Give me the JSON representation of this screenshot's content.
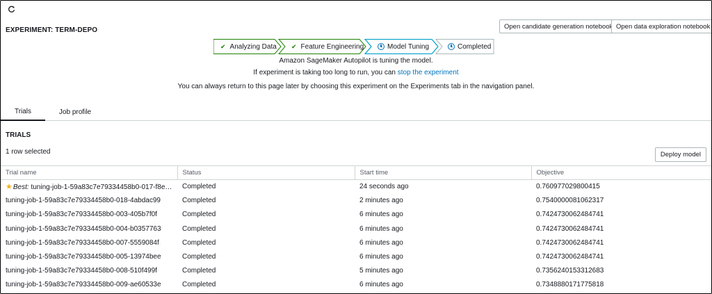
{
  "header": {
    "refresh_icon": "refresh-icon",
    "experiment_title": "EXPERIMENT: TERM-DEPO",
    "open_candidate_notebook_label": "Open candidate generation notebook",
    "open_data_notebook_label": "Open data exploration notebook"
  },
  "progress": {
    "steps": [
      {
        "label": "Analyzing Data",
        "state": "done",
        "icon": "check-icon"
      },
      {
        "label": "Feature Engineering",
        "state": "done",
        "icon": "check-icon"
      },
      {
        "label": "Model Tuning",
        "state": "in-progress",
        "icon": "clock-icon"
      },
      {
        "label": "Completed",
        "state": "pending",
        "icon": "clock-icon"
      }
    ]
  },
  "messages": {
    "tuning": "Amazon SageMaker Autopilot is tuning the model.",
    "long_run_prefix": "If experiment is taking too long to run, you can ",
    "stop_link": "stop the experiment",
    "return_info": "You can always return to this page later by choosing this experiment on the Experiments tab in the navigation panel."
  },
  "tabs": [
    {
      "label": "Trials",
      "active": true
    },
    {
      "label": "Job profile",
      "active": false
    }
  ],
  "trials": {
    "title": "TRIALS",
    "selected_count": "1 row selected",
    "deploy_label": "Deploy model",
    "columns": [
      "Trial name",
      "Status",
      "Start time",
      "Objective"
    ],
    "best_label": "Best:",
    "rows": [
      {
        "name": "tuning-job-1-59a83c7e79334458b0-017-f8ef4...",
        "status": "Completed",
        "start": "24 seconds ago",
        "objective": "0.760977029800415",
        "best": true
      },
      {
        "name": "tuning-job-1-59a83c7e79334458b0-018-4abdac99",
        "status": "Completed",
        "start": "2 minutes ago",
        "objective": "0.7540000081062317",
        "best": false
      },
      {
        "name": "tuning-job-1-59a83c7e79334458b0-003-405b7f0f",
        "status": "Completed",
        "start": "6 minutes ago",
        "objective": "0.7424730062484741",
        "best": false
      },
      {
        "name": "tuning-job-1-59a83c7e79334458b0-004-b0357763",
        "status": "Completed",
        "start": "6 minutes ago",
        "objective": "0.7424730062484741",
        "best": false
      },
      {
        "name": "tuning-job-1-59a83c7e79334458b0-007-5559084f",
        "status": "Completed",
        "start": "6 minutes ago",
        "objective": "0.7424730062484741",
        "best": false
      },
      {
        "name": "tuning-job-1-59a83c7e79334458b0-005-13974bee",
        "status": "Completed",
        "start": "6 minutes ago",
        "objective": "0.7424730062484741",
        "best": false
      },
      {
        "name": "tuning-job-1-59a83c7e79334458b0-008-510f499f",
        "status": "Completed",
        "start": "5 minutes ago",
        "objective": "0.7356240153312683",
        "best": false
      },
      {
        "name": "tuning-job-1-59a83c7e79334458b0-009-ae60533e",
        "status": "Completed",
        "start": "6 minutes ago",
        "objective": "0.7348880171775818",
        "best": false
      }
    ]
  },
  "colors": {
    "success": "#1d8102",
    "link": "#0073bb",
    "active_step": "#00a1c9",
    "star": "#f2b01e"
  }
}
